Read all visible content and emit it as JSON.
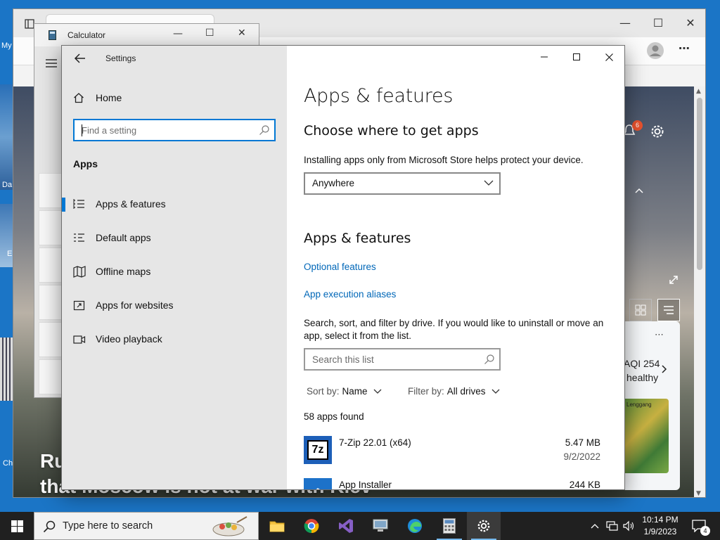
{
  "settings": {
    "window_title": "Settings",
    "nav": {
      "home_label": "Home",
      "search_placeholder": "Find a setting",
      "section_title": "Apps",
      "items": [
        {
          "label": "Apps & features",
          "icon": "apps-list-icon",
          "selected": true
        },
        {
          "label": "Default apps",
          "icon": "default-apps-icon",
          "selected": false
        },
        {
          "label": "Offline maps",
          "icon": "map-icon",
          "selected": false
        },
        {
          "label": "Apps for websites",
          "icon": "open-web-icon",
          "selected": false
        },
        {
          "label": "Video playback",
          "icon": "video-icon",
          "selected": false
        }
      ]
    },
    "main": {
      "page_title": "Apps & features",
      "choose_heading": "Choose where to get apps",
      "choose_desc": "Installing apps only from Microsoft Store helps protect your device.",
      "source_dropdown_value": "Anywhere",
      "features_heading": "Apps & features",
      "optional_features_link": "Optional features",
      "execution_aliases_link": "App execution aliases",
      "search_desc": "Search, sort, and filter by drive. If you would like to uninstall or move an app, select it from the list.",
      "search_placeholder": "Search this list",
      "sort_label": "Sort by:",
      "sort_value": "Name",
      "filter_label": "Filter by:",
      "filter_value": "All drives",
      "apps_found": "58 apps found",
      "apps": [
        {
          "name": "7-Zip 22.01 (x64)",
          "size": "5.47 MB",
          "date": "9/2/2022"
        },
        {
          "name": "App Installer",
          "size": "244 KB",
          "date": ""
        }
      ]
    }
  },
  "calculator": {
    "window_title": "Calculator"
  },
  "browser": {
    "notification_count": "6",
    "headline_line1": "Ru",
    "headline_line2": "that Moscow is not at war with Kiev",
    "weather_aqi": "AQI 254",
    "weather_status": "healthy",
    "map_label": "Lenggang"
  },
  "desktop": {
    "icon_labels": [
      "My",
      "Da",
      "E",
      "Ch"
    ]
  },
  "taskbar": {
    "search_text": "Type here to search",
    "time": "10:14 PM",
    "date": "1/9/2023",
    "notification_count": "4"
  },
  "colors": {
    "accent": "#0078d4",
    "link": "#0067b8",
    "taskbar": "#202020"
  }
}
